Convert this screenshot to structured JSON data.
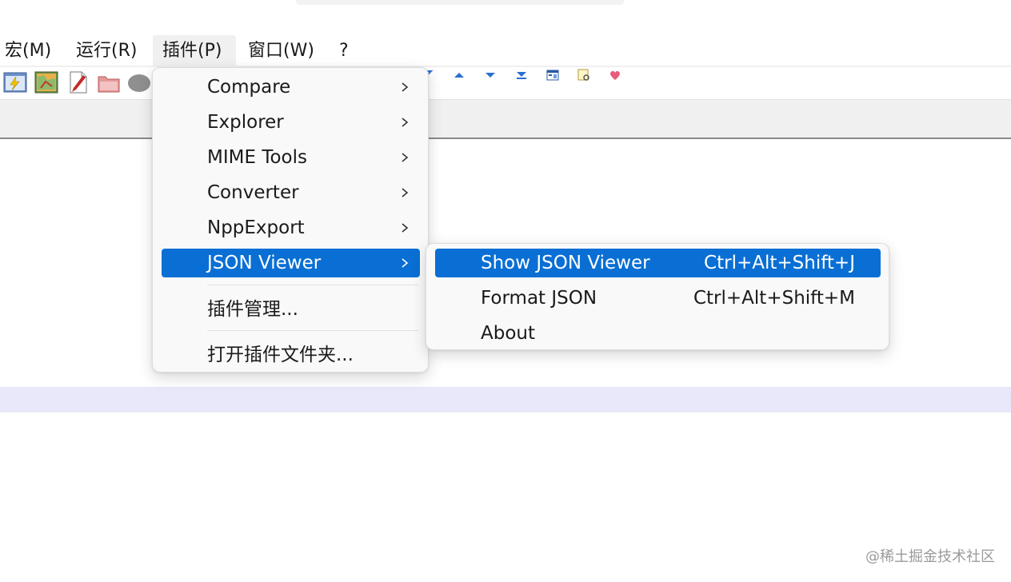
{
  "menubar": {
    "items": [
      {
        "label": "宏(M)"
      },
      {
        "label": "运行(R)"
      },
      {
        "label": "插件(P)"
      },
      {
        "label": "窗口(W)"
      },
      {
        "label": "?"
      }
    ]
  },
  "plugins_menu": {
    "items": [
      {
        "label": "Compare"
      },
      {
        "label": "Explorer"
      },
      {
        "label": "MIME Tools"
      },
      {
        "label": "Converter"
      },
      {
        "label": "NppExport"
      },
      {
        "label": "JSON Viewer"
      },
      {
        "label": "插件管理..."
      },
      {
        "label": "打开插件文件夹..."
      }
    ]
  },
  "json_viewer_menu": {
    "items": [
      {
        "label": "Show JSON Viewer",
        "shortcut": "Ctrl+Alt+Shift+J"
      },
      {
        "label": "Format JSON",
        "shortcut": "Ctrl+Alt+Shift+M"
      },
      {
        "label": "About",
        "shortcut": ""
      }
    ]
  },
  "watermark": "@稀土掘金技术社区",
  "colors": {
    "selection": "#0a6fd4",
    "menu_bg": "#f9f9f9",
    "tab_strip": "#f0f0f0",
    "current_line": "#e8e8fa"
  }
}
